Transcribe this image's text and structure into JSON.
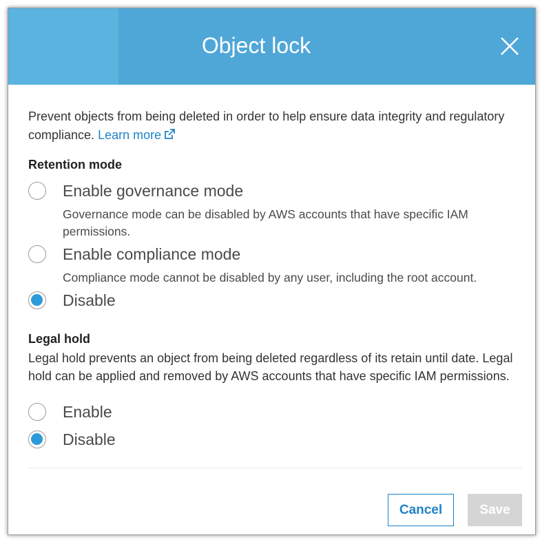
{
  "dialog": {
    "title": "Object lock",
    "close_icon": "close-x-icon",
    "header_color": "#4fa7d8"
  },
  "intro": {
    "text": "Prevent objects from being deleted in order to help ensure data integrity and regulatory compliance.",
    "learn_more": "Learn more",
    "learn_more_icon": "external-link-icon",
    "link_color": "#1f83c7"
  },
  "retention": {
    "heading": "Retention mode",
    "options": [
      {
        "label": "Enable governance mode",
        "description": "Governance mode can be disabled by AWS accounts that have specific IAM permissions.",
        "selected": false
      },
      {
        "label": "Enable compliance mode",
        "description": "Compliance mode cannot be disabled by any user, including the root account.",
        "selected": false
      },
      {
        "label": "Disable",
        "selected": true
      }
    ]
  },
  "legal_hold": {
    "heading": "Legal hold",
    "text": "Legal hold prevents an object from being deleted regardless of its retain until date. Legal hold can be applied and removed by AWS accounts that have specific IAM permissions.",
    "options": [
      {
        "label": "Enable",
        "selected": false
      },
      {
        "label": "Disable",
        "selected": true
      }
    ]
  },
  "footer": {
    "cancel_label": "Cancel",
    "save_label": "Save",
    "save_disabled": true
  },
  "colors": {
    "radio_selected": "#2c9ad9",
    "save_disabled_bg": "#d5d5d5"
  }
}
